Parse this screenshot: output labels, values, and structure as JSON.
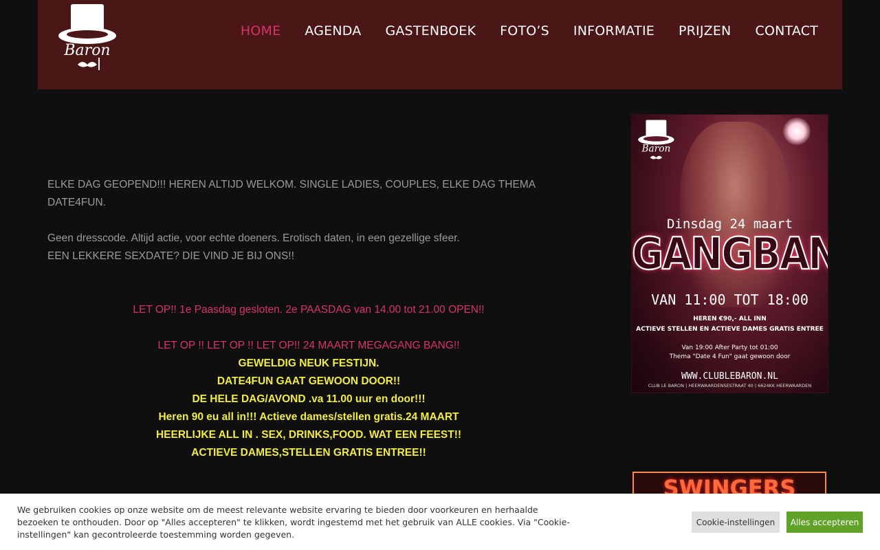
{
  "header": {
    "logo_alt": "Baron",
    "nav": [
      {
        "label": "HOME",
        "active": true
      },
      {
        "label": "AGENDA"
      },
      {
        "label": "GASTENBOEK"
      },
      {
        "label": "FOTO’S"
      },
      {
        "label": "INFORMATIE"
      },
      {
        "label": "PRIJZEN"
      },
      {
        "label": "CONTACT"
      }
    ]
  },
  "main": {
    "intro": "ELKE DAG GEOPEND!!! HEREN ALTIJD WELKOM. SINGLE LADIES, COUPLES, ELKE DAG THEMA DATE4FUN.",
    "line2": "Geen dresscode. Altijd actie, voor echte doeners. Erotisch daten, in een gezellige sfeer.",
    "line3": "EEN LEKKERE SEXDATE? DIE VIND JE BIJ ONS!!",
    "notice1": "LET OP!! 1e Paasdag gesloten. 2e PAASDAG van 14.00 tot 21.00 OPEN!!",
    "notice2": "LET OP !! LET OP !! LET OP!!  24 MAART MEGAGANG BANG!!",
    "yellow_lines": [
      "GEWELDIG NEUK FESTIJN.",
      "DATE4FUN GAAT GEWOON DOOR!!",
      "DE HELE DAG/AVOND .va 11.00 uur en door!!!",
      "Heren 90 eu all in!!! Actieve dames/stellen gratis.24 MAART",
      "HEERLIJKE ALL IN . SEX, DRINKS,FOOD. WAT EEN FEEST!!",
      "ACTIEVE DAMES,STELLEN GRATIS ENTREE!!"
    ]
  },
  "poster": {
    "date": "Dinsdag 24 maart",
    "title": "GANGBANG",
    "time": "VAN 11:00 TOT 18:00",
    "price": "HEREN €90,- ALL INN",
    "free": "ACTIEVE STELLEN EN ACTIEVE DAMES GRATIS ENTREE",
    "after": "Van 19:00 After Party tot 01:00",
    "theme": "Thema \"Date 4 Fun\" gaat gewoon door",
    "web": "WWW.CLUBLEBARON.NL",
    "address": "CLUB LE BARON | HEERWAARDENSESTRAAT 40 | 6624KK HEERWAARDEN"
  },
  "banner2": {
    "text": "SWINGERS CAFÉ"
  },
  "cookie": {
    "text": "We gebruiken cookies op onze website om de meest relevante website ervaring te bieden door voorkeuren en herhaalde bezoeken te onthouden. Door op \"Alles accepteren\" te klikken, wordt ingestemd met het gebruik van ALLE cookies. Via \"Cookie-instellingen\" kan gecontroleerde toestemming worden gegeven.",
    "settings_label": "Cookie-instellingen",
    "accept_label": "Alles accepteren"
  },
  "colors": {
    "header_bg": "#4a1616",
    "active_nav": "#d5336b",
    "pink_text": "#d8336b",
    "yellow_text": "#f2ec45",
    "accept_button": "#61a229"
  }
}
